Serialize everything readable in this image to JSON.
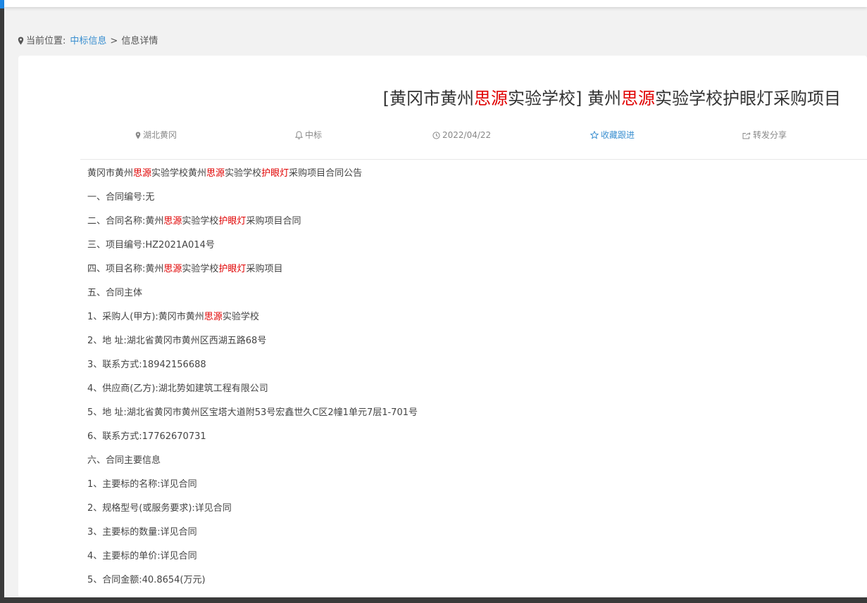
{
  "breadcrumb": {
    "prefix": "当前位置:",
    "link": "中标信息",
    "separator": ">",
    "current": "信息详情"
  },
  "title": {
    "bracket_open": "[黄冈市黄州",
    "hl1": "思源",
    "mid1": "实验学校] 黄州",
    "hl2": "思源",
    "tail": "实验学校护眼灯采购项目"
  },
  "meta": {
    "region": "湖北黄冈",
    "type": "中标",
    "date": "2022/04/22",
    "favorite": "收藏跟进",
    "share": "转发分享"
  },
  "content": {
    "l1": {
      "a": "黄冈市黄州",
      "b": "思源",
      "c": "实验学校黄州",
      "d": "思源",
      "e": "实验学校",
      "f": "护眼灯",
      "g": "采购项目合同公告"
    },
    "l2": "一、合同编号:无",
    "l3": {
      "a": "二、合同名称:黄州",
      "b": "思源",
      "c": "实验学校",
      "d": "护眼灯",
      "e": "采购项目合同"
    },
    "l4": "三、项目编号:HZ2021A014号",
    "l5": {
      "a": "四、项目名称:黄州",
      "b": "思源",
      "c": "实验学校",
      "d": "护眼灯",
      "e": "采购项目"
    },
    "l6": "五、合同主体",
    "l7": {
      "a": "1、采购人(甲方):黄冈市黄州",
      "b": "思源",
      "c": "实验学校"
    },
    "l8": "2、地 址:湖北省黄冈市黄州区西湖五路68号",
    "l9": "3、联系方式:18942156688",
    "l10": "4、供应商(乙方):湖北势如建筑工程有限公司",
    "l11": "5、地 址:湖北省黄冈市黄州区宝塔大道附53号宏鑫世久C区2幢1单元7层1-701号",
    "l12": "6、联系方式:17762670731",
    "l13": "六、合同主要信息",
    "l14": "1、主要标的名称:详见合同",
    "l15": "2、规格型号(或服务要求):详见合同",
    "l16": "3、主要标的数量:详见合同",
    "l17": "4、主要标的单价:详见合同",
    "l18": "5、合同金额:40.8654(万元)"
  },
  "colors": {
    "highlight": "#e00000",
    "link": "#3a8fd0"
  },
  "icons": [
    "map-pin-icon",
    "bell-icon",
    "clock-icon",
    "star-icon",
    "share-icon"
  ]
}
